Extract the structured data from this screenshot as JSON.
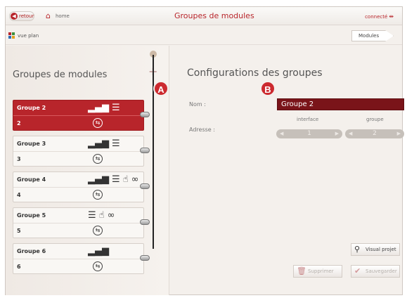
{
  "topbar": {
    "retour_label": "retour",
    "home_label": "home",
    "title": "Groupes de modules",
    "connection_label": "connecté"
  },
  "subbar": {
    "vue_plan_label": "vue plan",
    "breadcrumb_label": "Modules"
  },
  "left": {
    "title": "Groupes de modules",
    "groups": [
      {
        "name": "Groupe 2",
        "number": "2",
        "icons": [
          "signal-icon",
          "traffic-light-icon"
        ],
        "selected": true
      },
      {
        "name": "Groupe 3",
        "number": "3",
        "icons": [
          "signal-icon",
          "traffic-light-icon"
        ],
        "selected": false
      },
      {
        "name": "Groupe 4",
        "number": "4",
        "icons": [
          "signal-icon",
          "traffic-light-icon",
          "hand-pointer-icon",
          "link-icon"
        ],
        "selected": false
      },
      {
        "name": "Groupe 5",
        "number": "5",
        "icons": [
          "traffic-light-icon",
          "hand-pointer-icon",
          "link-icon"
        ],
        "selected": false
      },
      {
        "name": "Groupe 6",
        "number": "6",
        "icons": [
          "signal-icon"
        ],
        "selected": false
      }
    ]
  },
  "badges": {
    "a": "A",
    "b": "B"
  },
  "right": {
    "title": "Configurations des groupes",
    "nom_label": "Nom :",
    "nom_value": "Groupe 2",
    "adresse_label": "Adresse :",
    "interface_label": "interface",
    "interface_value": "1",
    "groupe_label": "groupe",
    "groupe_value": "2",
    "visual_label": "Visual projet",
    "supprimer_label": "Supprimer",
    "sauvegarder_label": "Sauvegarder"
  },
  "colors": {
    "accent": "#b8252b",
    "dark_accent": "#7a1419",
    "background": "#f4f0ec"
  }
}
